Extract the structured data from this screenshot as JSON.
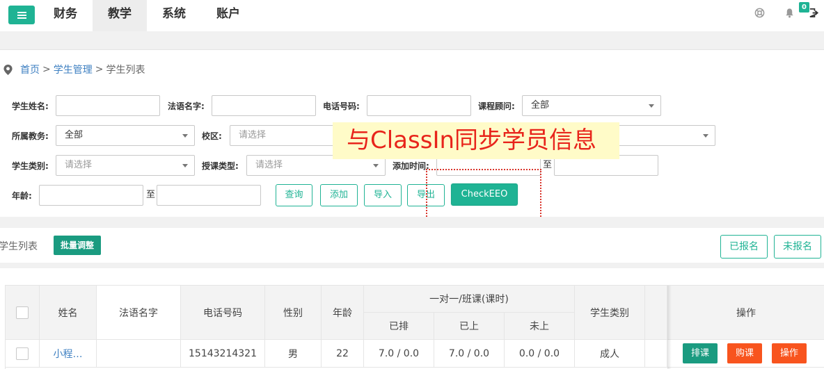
{
  "topnav": {
    "items": [
      "财务",
      "教学",
      "系统",
      "账户"
    ],
    "active": "教学",
    "notification_count": "0"
  },
  "breadcrumb": {
    "home": "首页",
    "section": "学生管理",
    "current": "学生列表",
    "separator": ">"
  },
  "filters": {
    "student_name_label": "学生姓名:",
    "french_name_label": "法语名字:",
    "phone_label": "电话号码:",
    "advisor_label": "课程顾问:",
    "advisor_value": "全部",
    "academic_label": "所属教务:",
    "academic_value": "全部",
    "campus_label": "校区:",
    "campus_placeholder": "请选择",
    "student_type_label": "学生类别:",
    "student_type_placeholder": "请选择",
    "teaching_type_label": "授课类型:",
    "teaching_type_placeholder": "请选择",
    "added_time_label": "添加时间:",
    "range_to": "至",
    "age_label": "年龄:"
  },
  "actions": {
    "query": "查询",
    "add": "添加",
    "import": "导入",
    "export": "导出",
    "check_eeo": "CheckEEO"
  },
  "annotation": {
    "text": "与ClassIn同步学员信息",
    "text_color": "#e8241b",
    "bg_color": "#fffbc8"
  },
  "list": {
    "title": "学生列表",
    "batch_adjust": "批量调整",
    "tab_enrolled": "已报名",
    "tab_not_enrolled": "未报名"
  },
  "table": {
    "headers": {
      "name": "姓名",
      "french_name": "法语名字",
      "phone": "电话号码",
      "gender": "性别",
      "age": "年龄",
      "group": "一对一/班课(课时)",
      "scheduled": "已排",
      "attended": "已上",
      "not_attended": "未上",
      "student_type": "学生类别",
      "operations": "操作"
    },
    "rows": [
      {
        "name": "小程…",
        "french_name": "",
        "phone": "15143214321",
        "gender": "男",
        "age": "22",
        "scheduled": "7.0 / 0.0",
        "attended": "7.0 / 0.0",
        "not_attended": "0.0 / 0.0",
        "student_type": "成人",
        "btn_schedule": "排课",
        "btn_purchase": "购课",
        "btn_operate": "操作"
      }
    ]
  },
  "colors": {
    "accent": "#1fb394",
    "link": "#3d7fc1",
    "orange": "#f8541e"
  }
}
